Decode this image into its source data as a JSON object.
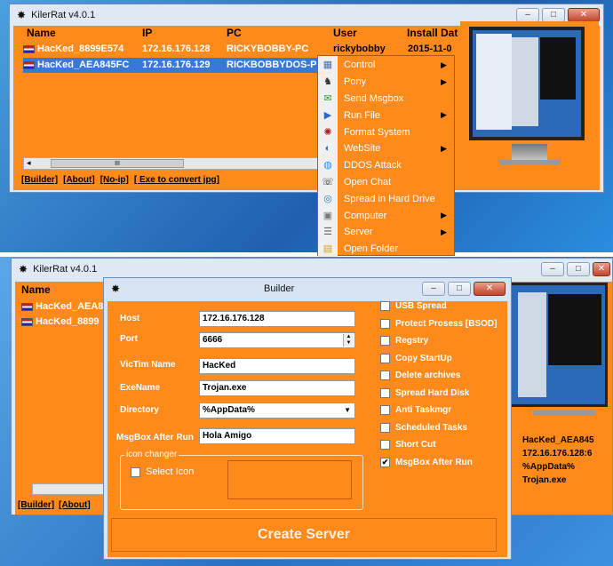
{
  "top_window": {
    "title": "KilerRat v4.0.1",
    "columns": [
      "Name",
      "IP",
      "PC",
      "User",
      "Install Dat"
    ],
    "rows": [
      {
        "name": "HacKed_8899E574",
        "ip": "172.16.176.128",
        "pc": "RICKYBOBBY-PC",
        "user": "rickybobby",
        "install": "2015-11-0"
      },
      {
        "name": "HacKed_AEA845FC",
        "ip": "172.16.176.129",
        "pc": "RICKBOBBYDOS-P",
        "user": "",
        "install": ""
      }
    ],
    "links": [
      "[Builder]",
      "[About]",
      "[No-ip]",
      "[ Exe to convert jpg]"
    ],
    "scroll_thumb": "III",
    "window_buttons": {
      "min": "–",
      "max": "□",
      "close": "✕"
    }
  },
  "context_menu": {
    "items": [
      {
        "label": "Control",
        "icon": "control-icon",
        "submenu": true
      },
      {
        "label": "Pony",
        "icon": "pony-icon",
        "submenu": true
      },
      {
        "label": "Send Msgbox",
        "icon": "msgbox-icon",
        "submenu": false
      },
      {
        "label": "Run File",
        "icon": "run-file-icon",
        "submenu": true
      },
      {
        "label": "Format System",
        "icon": "bug-icon",
        "submenu": false
      },
      {
        "label": "WebSite",
        "icon": "website-icon",
        "submenu": true
      },
      {
        "label": "DDOS Attack",
        "icon": "ddos-icon",
        "submenu": false
      },
      {
        "label": "Open Chat",
        "icon": "chat-icon",
        "submenu": false
      },
      {
        "label": "Spread in Hard Drive",
        "icon": "spread-icon",
        "submenu": false
      },
      {
        "label": "Computer",
        "icon": "computer-icon",
        "submenu": true
      },
      {
        "label": "Server",
        "icon": "server-icon",
        "submenu": true
      },
      {
        "label": "Open Folder",
        "icon": "folder-icon",
        "submenu": false
      }
    ],
    "arrow": "▶"
  },
  "bottom_window": {
    "title": "KilerRat v4.0.1",
    "column_name": "Name",
    "rows": [
      "HacKed_AEA8",
      "HacKed_8899"
    ],
    "links": [
      "[Builder]",
      "[About]"
    ],
    "right_info": [
      "HacKed_AEA845",
      "172.16.176.128:6",
      "%AppData%",
      "Trojan.exe"
    ],
    "scroll_thumb": "III"
  },
  "builder": {
    "title": "Builder",
    "fields": {
      "host_label": "Host",
      "host_value": "172.16.176.128",
      "port_label": "Port",
      "port_value": "6666",
      "victim_label": "VicTim Name",
      "victim_value": "HacKed",
      "exename_label": "ExeName",
      "exename_value": "Trojan.exe",
      "directory_label": "Directory",
      "directory_value": "%AppData%",
      "msgbox_label": "MsgBox After Run",
      "msgbox_value": "Hola Amigo"
    },
    "icon_changer_legend": "icon changer",
    "select_icon_label": "Select Icon",
    "options": [
      {
        "label": "USB Spread",
        "checked": false
      },
      {
        "label": "Protect Prosess [BSOD]",
        "checked": false
      },
      {
        "label": "Regstry",
        "checked": false
      },
      {
        "label": "Copy StartUp",
        "checked": false
      },
      {
        "label": "Delete archives",
        "checked": false
      },
      {
        "label": "Spread Hard Disk",
        "checked": false
      },
      {
        "label": "Anti Taskmgr",
        "checked": false
      },
      {
        "label": "Scheduled Tasks",
        "checked": false
      },
      {
        "label": "Short Cut",
        "checked": false
      },
      {
        "label": "MsgBox After Run",
        "checked": true
      }
    ],
    "create_button": "Create Server",
    "check_mark": "✔",
    "dropdown_arrow": "▼",
    "spin_up": "▲",
    "spin_down": "▼"
  },
  "colors": {
    "accent": "#ff8a1c",
    "selection": "#3a78d8",
    "desktop": "#1f6fc0"
  }
}
